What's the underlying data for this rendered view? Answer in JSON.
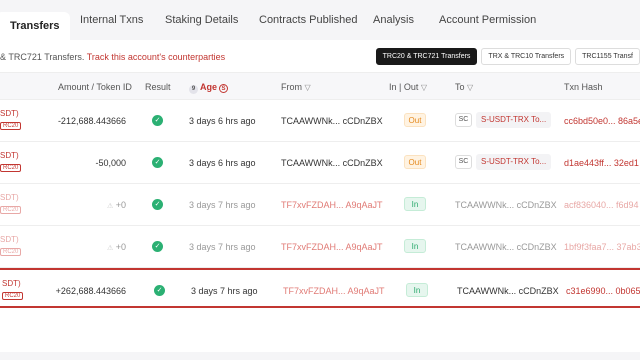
{
  "tabs": [
    {
      "label": "Transfers",
      "active": true
    },
    {
      "label": "Internal Txns"
    },
    {
      "label": "Staking Details"
    },
    {
      "label": "Contracts Published"
    },
    {
      "label": "Analysis"
    },
    {
      "label": "Account Permission"
    }
  ],
  "subheader": {
    "text": "& TRC721 Transfers.",
    "warning": "Track this account's counterparties"
  },
  "filters": [
    "TRC20 & TRC721 Transfers",
    "TRX & TRC10 Transfers",
    "TRC1155 Transf"
  ],
  "columns": {
    "amount": "Amount / Token ID",
    "result": "Result",
    "age_badge": "9",
    "age": "Age",
    "age_icon": "S",
    "from": "From",
    "inout": "In | Out",
    "to": "To",
    "hash": "Txn Hash",
    "filter_icon": "▽"
  },
  "rows": [
    {
      "token": "SDT)",
      "token2": "RC20",
      "amount": "-212,688.443666",
      "result_icon": "check-icon",
      "result_glyph": "✓",
      "age": "3 days 6 hrs ago",
      "from": "TCAAWWNk... cCDnZBX",
      "dir": "Out",
      "sc": "SC",
      "to": "S-USDT-TRX To...",
      "hash": "cc6bd50e0... 86a5e",
      "faded": false
    },
    {
      "token": "SDT)",
      "token2": "RC20",
      "amount": "-50,000",
      "result_icon": "check-icon",
      "result_glyph": "✓",
      "age": "3 days 6 hrs ago",
      "from": "TCAAWWNk... cCDnZBX",
      "dir": "Out",
      "sc": "SC",
      "to": "S-USDT-TRX To...",
      "hash": "d1ae443ff... 32ed1",
      "faded": false
    },
    {
      "token": "SDT)",
      "token2": "RC20",
      "amount": "+0",
      "ghost": "⚠",
      "result_icon": "check-icon",
      "result_glyph": "✓",
      "age": "3 days 7 hrs ago",
      "from": "TF7xvFZDAH... A9qAaJT",
      "dir": "In",
      "to_addr": "TCAAWWNk... cCDnZBX",
      "hash": "acf836040... f6d94",
      "faded": true
    },
    {
      "token": "SDT)",
      "token2": "RC20",
      "amount": "+0",
      "ghost": "⚠",
      "result_icon": "check-icon",
      "result_glyph": "✓",
      "age": "3 days 7 hrs ago",
      "from": "TF7xvFZDAH... A9qAaJT",
      "dir": "In",
      "to_addr": "TCAAWWNk... cCDnZBX",
      "hash": "1bf9f3faa7... 37ab3",
      "faded": true
    },
    {
      "token": "SDT)",
      "token2": "RC20",
      "amount": "+262,688.443666",
      "result_icon": "check-icon",
      "result_glyph": "✓",
      "age": "3 days 7 hrs ago",
      "from": "TF7xvFZDAH... A9qAaJT",
      "dir": "In",
      "to_addr": "TCAAWWNk... cCDnZBX",
      "hash": "c31e6990... 0b065",
      "faded": false,
      "highlighted": true
    }
  ],
  "colors": {
    "accent": "#c23631",
    "success": "#2bb073",
    "out": "#e48a20",
    "in": "#2aa86c"
  }
}
